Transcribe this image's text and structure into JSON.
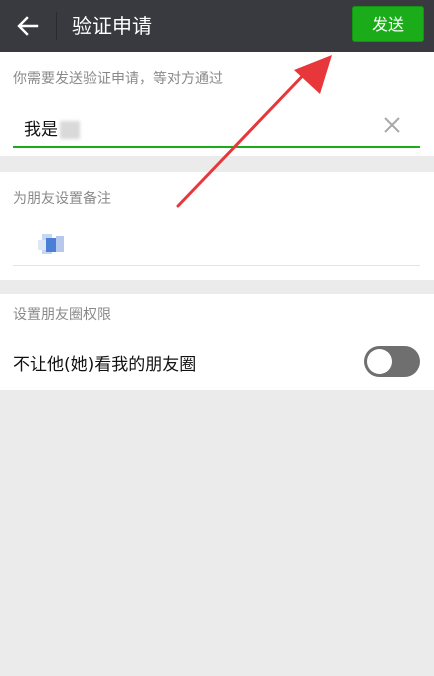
{
  "header": {
    "title": "验证申请",
    "send_label": "发送"
  },
  "request_section": {
    "label": "你需要发送验证申请，等对方通过",
    "value": "我是"
  },
  "remark_section": {
    "label": "为朋友设置备注"
  },
  "moments_section": {
    "label": "设置朋友圈权限",
    "toggle_label": "不让他(她)看我的朋友圈",
    "toggle_on": false
  },
  "colors": {
    "topbar": "#393a3f",
    "send_button": "#1aad19",
    "annotation_arrow": "#e8373a"
  }
}
